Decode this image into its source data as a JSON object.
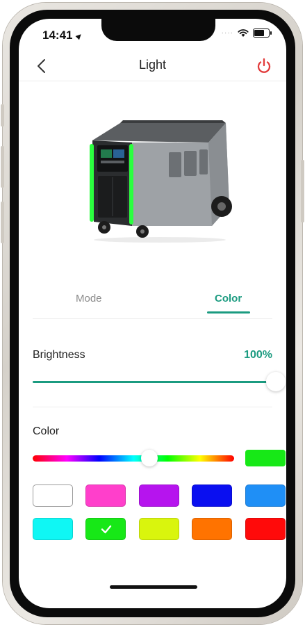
{
  "status_bar": {
    "time": "14:41"
  },
  "header": {
    "title": "Light"
  },
  "tabs": [
    {
      "label": "Mode",
      "active": false
    },
    {
      "label": "Color",
      "active": true
    }
  ],
  "brightness": {
    "label": "Brightness",
    "value_text": "100%",
    "level": 1.0
  },
  "color_section": {
    "label": "Color",
    "hue_position": 0.58,
    "selected_color": "#17e817",
    "swatches": [
      {
        "color": "#ffffff",
        "selected": false
      },
      {
        "color": "#ff3fcb",
        "selected": false
      },
      {
        "color": "#b614ee",
        "selected": false
      },
      {
        "color": "#0a0ff0",
        "selected": false
      },
      {
        "color": "#1f8ff6",
        "selected": false
      },
      {
        "color": "#0ff7f4",
        "selected": false
      },
      {
        "color": "#17e817",
        "selected": true
      },
      {
        "color": "#d9f50d",
        "selected": false
      },
      {
        "color": "#ff7300",
        "selected": false
      },
      {
        "color": "#ff0a0a",
        "selected": false
      }
    ]
  },
  "colors": {
    "accent": "#1b9b80",
    "power": "#e23b3b"
  }
}
